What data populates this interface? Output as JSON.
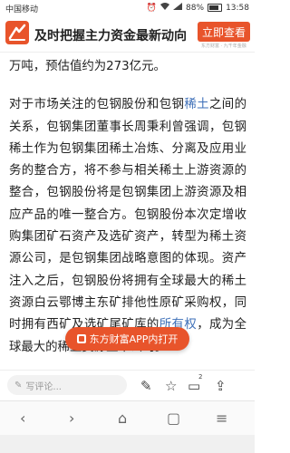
{
  "status_bar": {
    "carrier": "中国移动",
    "battery": "88%",
    "time": "13:58",
    "icons": [
      "alarm-icon",
      "wifi-icon",
      "signal-icon",
      "battery-icon"
    ]
  },
  "header": {
    "title": "及时把握主力资金最新动向",
    "open_button": "立即查看",
    "open_sub": "东方财富 · 九千年金融"
  },
  "article": {
    "line_top": "万吨，预估值约为273亿元。",
    "p2_before": "对于市场关注的包钢股份和包钢",
    "p2_kw1": "稀土",
    "p2_mid": "之间的关系，包钢集团董事长周秉利曾强调，包钢稀土作为包钢集团稀土冶炼、分离及应用业务的整合方，将不参与相关稀土上游资源的整合，包钢股份将是包钢集团上游资源及相应产品的唯一整合方。包钢股份本次定增收购集团矿石资产及选矿资产，转型为稀土资源公司，是包钢集团战略意图的体现。资产注入之后，包钢股份将拥有全球最大的稀土资源白云鄂博主东矿排他性原矿采购权，同时拥有西矿及选矿尾矿库的",
    "p2_kw2": "所有权",
    "p2_end": "，成为全球最大的稀土资源上市公司。"
  },
  "float_button": {
    "label": "东方财富APP内打开"
  },
  "comment_bar": {
    "placeholder": "写评论...",
    "share_count": "2"
  },
  "colors": {
    "brand": "#e8542b",
    "keyword": "#3d6fb8"
  }
}
